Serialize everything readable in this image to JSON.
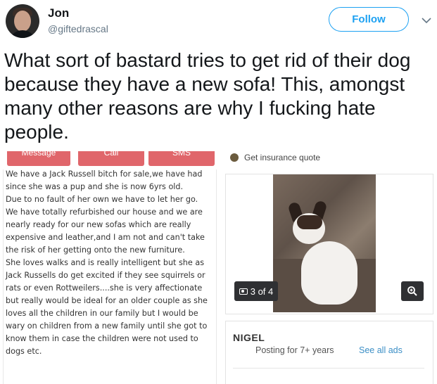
{
  "user": {
    "name": "Jon",
    "handle": "@giftedrascal",
    "follow_label": "Follow"
  },
  "tweet": {
    "text": "What sort of bastard tries to get rid of their dog because they have a new sofa! This, amongst many other reasons are why I fucking hate people."
  },
  "embed": {
    "tabs": [
      "Message",
      "Call",
      "SMS"
    ],
    "insurance_label": "Get insurance quote",
    "ad_text_lines": [
      "We have a Jack Russell bitch for sale,we have had",
      "since she was a pup and she is now 6yrs old.",
      "Due to no fault of her own we have to let her go.",
      "We have totally refurbished our house and we are",
      "nearly ready for our new sofas which are really",
      "expensive and leather,and I am not and can't take",
      "the risk of her getting onto the new furniture.",
      "She loves walks and is really intelligent but she as",
      "Jack Russells do get excited if they see squirrels or",
      "rats or even Rottweilers....she is very affectionate",
      "but really would be ideal for an older couple as she",
      "loves all the children in our family but I would be",
      "wary on children from a new family until she got to",
      "know them in case the children were not used to",
      "dogs etc."
    ],
    "photo_counter": "3 of 4",
    "seller": {
      "name": "NIGEL",
      "posting": "Posting for 7+ years",
      "see_all": "See all ads"
    }
  },
  "colors": {
    "follow_blue": "#1da1f2",
    "tab_red": "#e0666b",
    "link_blue": "#3c8fc6"
  }
}
